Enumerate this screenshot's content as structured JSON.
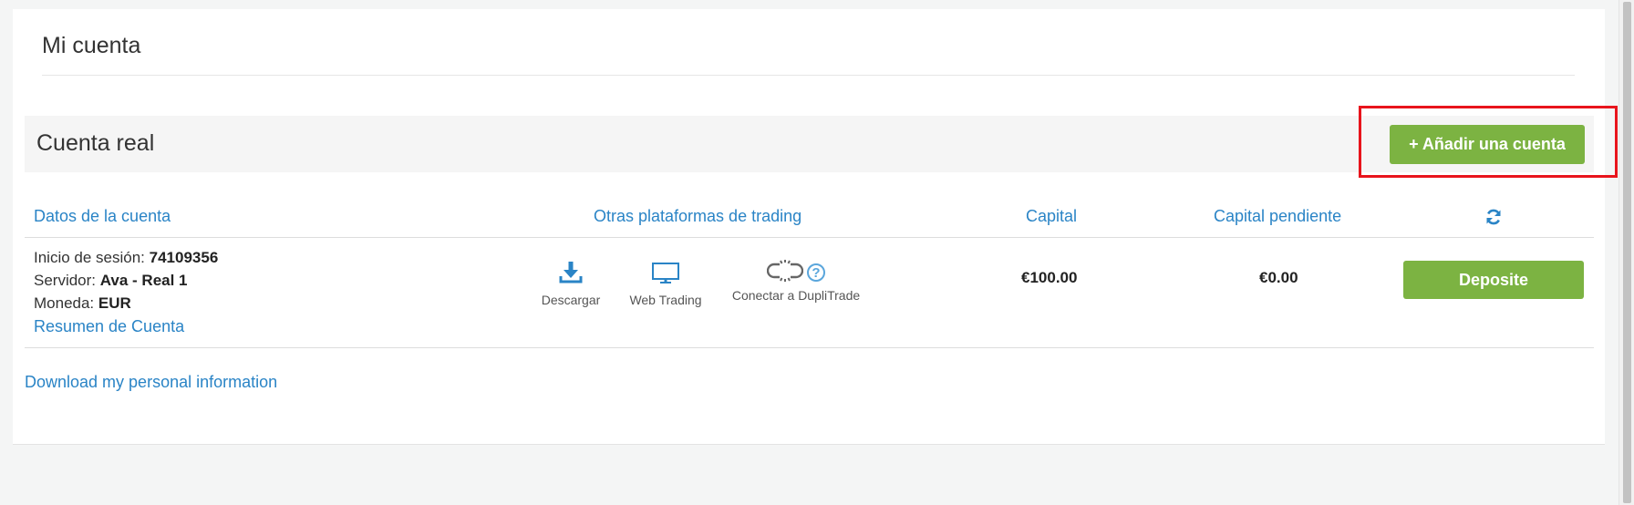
{
  "page": {
    "title": "Mi cuenta"
  },
  "account_section": {
    "title": "Cuenta real",
    "add_button_label": "+ Añadir una cuenta"
  },
  "table": {
    "headers": {
      "details": "Datos de la cuenta",
      "platforms": "Otras plataformas de trading",
      "capital": "Capital",
      "pending": "Capital pendiente",
      "refresh_icon": "refresh-icon"
    },
    "row": {
      "login_label": "Inicio de sesión:",
      "login_value": "74109356",
      "server_label": "Servidor:",
      "server_value": "Ava - Real 1",
      "currency_label": "Moneda:",
      "currency_value": "EUR",
      "summary_link": "Resumen de Cuenta",
      "platforms": [
        {
          "label": "Descargar",
          "icon": "download-icon"
        },
        {
          "label": "Web Trading",
          "icon": "monitor-icon"
        },
        {
          "label": "Conectar a DupliTrade",
          "icon": "broken-link-icon"
        }
      ],
      "capital": "€100.00",
      "pending": "€0.00",
      "deposit_label": "Deposite"
    }
  },
  "footer": {
    "download_info_link": "Download my personal information"
  },
  "colors": {
    "accent_blue": "#2a84c6",
    "button_green": "#7cb342",
    "highlight_red": "#e8141c"
  }
}
